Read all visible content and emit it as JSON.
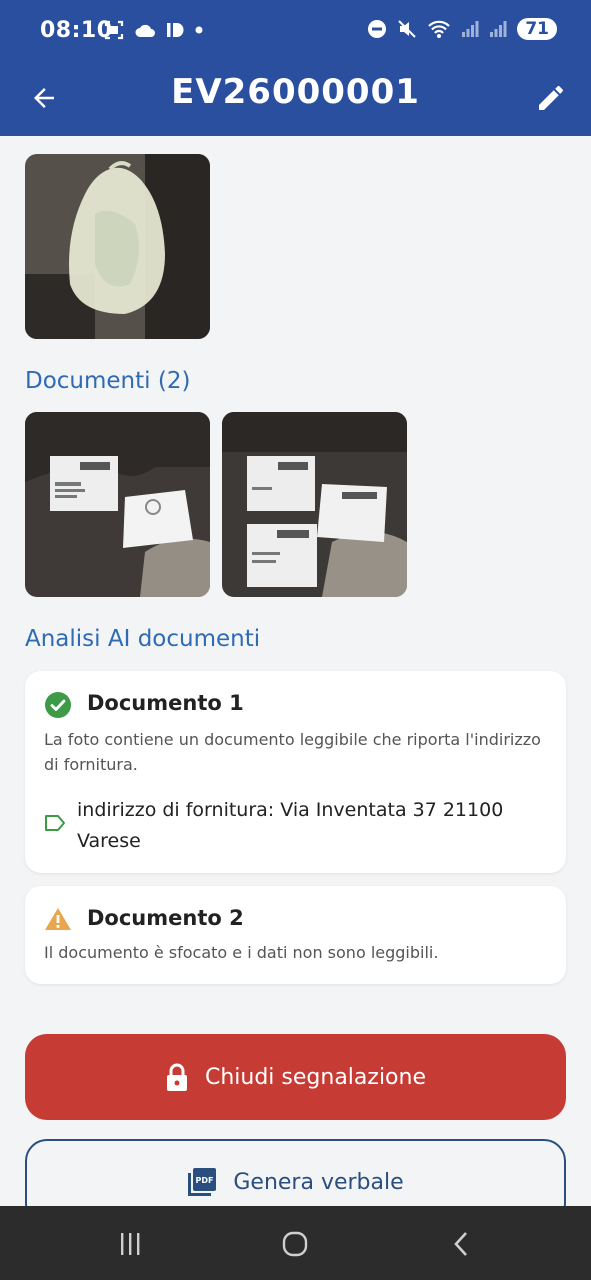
{
  "status_bar": {
    "time": "08:10",
    "battery": "71",
    "left_icons": [
      "screenshot-icon",
      "cloud-icon",
      "id-icon",
      "dot-icon"
    ],
    "right_icons": [
      "dnd-icon",
      "mute-icon",
      "wifi-icon",
      "signal-icon",
      "signal-icon"
    ]
  },
  "app_bar": {
    "title": "EV26000001",
    "back_icon": "arrow-back-icon",
    "edit_icon": "pencil-icon",
    "color": "#2a4f9f"
  },
  "photos": {
    "items": [
      {
        "alt": "bag-photo"
      }
    ]
  },
  "documents": {
    "title": "Documenti (2)",
    "items": [
      {
        "alt": "document-photo-1"
      },
      {
        "alt": "document-photo-2"
      }
    ]
  },
  "analysis": {
    "title": "Analisi AI documenti",
    "cards": [
      {
        "status": "ok",
        "title": "Documento 1",
        "text": "La foto contiene un documento leggibile che riporta l'indirizzo di fornitura.",
        "tag_line_1": "indirizzo di fornitura: Via Inventata 37 21100",
        "tag_line_2": "Varese"
      },
      {
        "status": "warning",
        "title": "Documento 2",
        "text": "Il documento è sfocato e i dati non sono leggibili."
      }
    ]
  },
  "actions": {
    "close_label": "Chiudi segnalazione",
    "pdf_label": "Genera verbale",
    "close_color": "#c63b34"
  },
  "nav_bar": {
    "icons": [
      "recents-icon",
      "home-icon",
      "back-nav-icon"
    ]
  }
}
